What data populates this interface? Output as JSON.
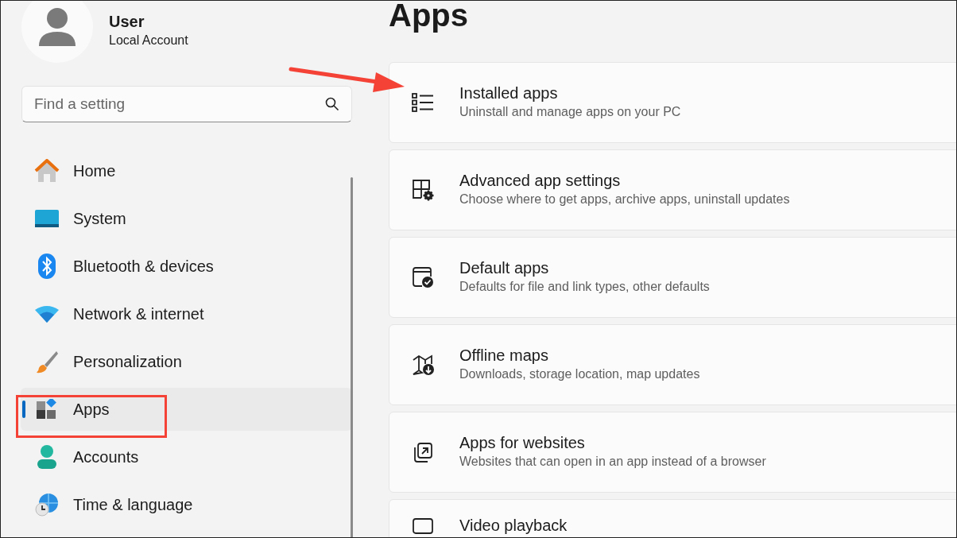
{
  "profile": {
    "name": "User",
    "account": "Local Account"
  },
  "search": {
    "placeholder": "Find a setting"
  },
  "nav": [
    {
      "label": "Home",
      "selected": false
    },
    {
      "label": "System",
      "selected": false
    },
    {
      "label": "Bluetooth & devices",
      "selected": false
    },
    {
      "label": "Network & internet",
      "selected": false
    },
    {
      "label": "Personalization",
      "selected": false
    },
    {
      "label": "Apps",
      "selected": true
    },
    {
      "label": "Accounts",
      "selected": false
    },
    {
      "label": "Time & language",
      "selected": false
    }
  ],
  "page_title": "Apps",
  "cards": [
    {
      "title": "Installed apps",
      "description": "Uninstall and manage apps on your PC"
    },
    {
      "title": "Advanced app settings",
      "description": "Choose where to get apps, archive apps, uninstall updates"
    },
    {
      "title": "Default apps",
      "description": "Defaults for file and link types, other defaults"
    },
    {
      "title": "Offline maps",
      "description": "Downloads, storage location, map updates"
    },
    {
      "title": "Apps for websites",
      "description": "Websites that can open in an app instead of a browser"
    },
    {
      "title": "Video playback"
    }
  ],
  "annotations": [
    {
      "kind": "arrow",
      "color": "#f44336"
    },
    {
      "kind": "box",
      "color": "#f44336"
    }
  ]
}
